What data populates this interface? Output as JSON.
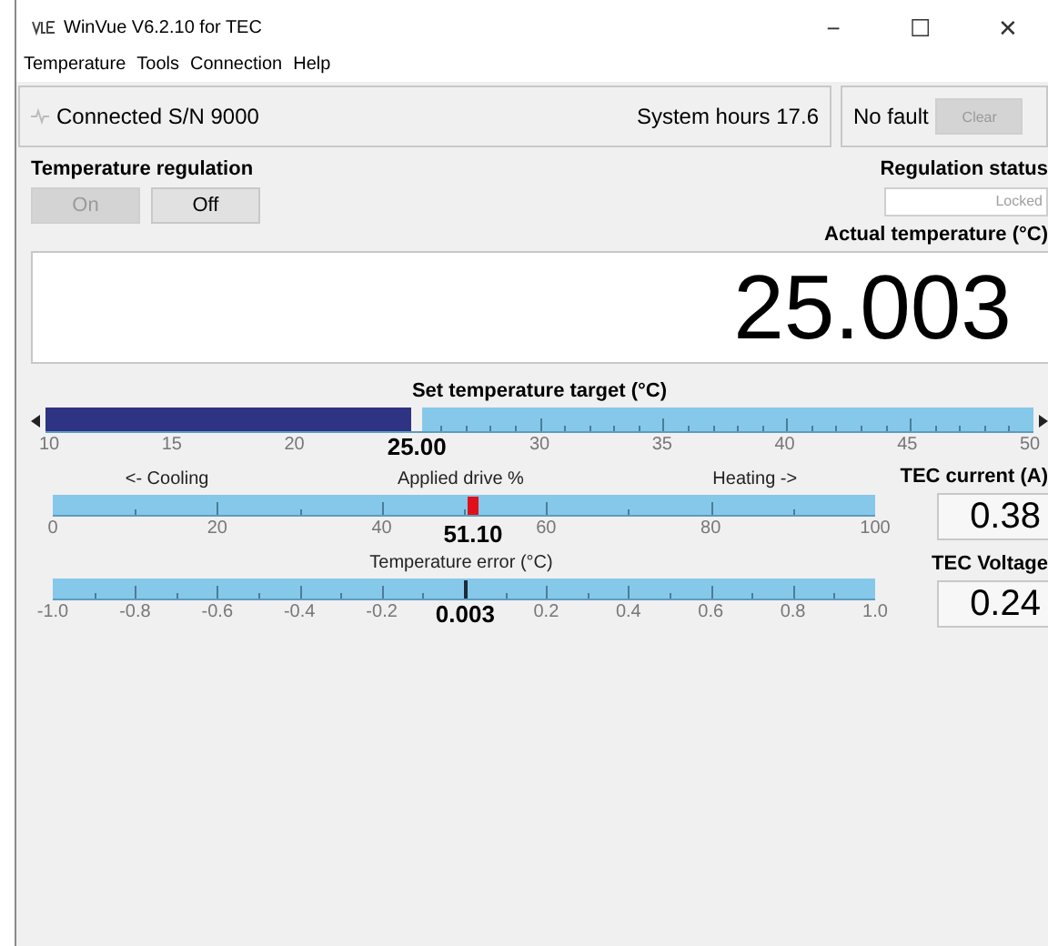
{
  "window": {
    "title": "WinVue V6.2.10 for TEC",
    "controls": [
      "−",
      "☐",
      "✕"
    ]
  },
  "menu": [
    "Temperature",
    "Tools",
    "Connection",
    "Help"
  ],
  "status": {
    "connection": "Connected S/N 9000",
    "hours": "System hours 17.6",
    "fault": "No fault",
    "clear": {
      "label": "Clear",
      "disabled": true
    }
  },
  "regulation": {
    "title": "Temperature regulation",
    "buttons": [
      {
        "label": "On",
        "disabled": true
      },
      {
        "label": "Off",
        "disabled": false
      }
    ],
    "status_label": "Regulation status",
    "status_value": "Locked"
  },
  "actual": {
    "label": "Actual temperature (°C)",
    "value": "25.003"
  },
  "scales": [
    {
      "kind": "slider",
      "title": "Set temperature target (°C)",
      "level": 0.375,
      "value": "25.00",
      "ticks": [
        "10",
        "15",
        "20",
        "30",
        "35",
        "40",
        "45",
        "50"
      ]
    },
    {
      "kind": "bar",
      "title": "Applied drive %",
      "left": "<- Cooling",
      "right": "Heating ->",
      "level": 0.511,
      "value": "51.10",
      "ticks": [
        "0",
        "20",
        "40",
        "60",
        "80",
        "100"
      ]
    },
    {
      "kind": "needle",
      "title": "Temperature error (°C)",
      "level": 0.5015,
      "value": "0.003",
      "ticks": [
        "-1.0",
        "-0.8",
        "-0.6",
        "-0.4",
        "-0.2",
        "0.2",
        "0.4",
        "0.6",
        "0.8",
        "1.0"
      ]
    }
  ],
  "readouts": [
    {
      "label": "TEC current (A)",
      "value": "0.38"
    },
    {
      "label": "TEC Voltage",
      "value": "0.24"
    }
  ]
}
